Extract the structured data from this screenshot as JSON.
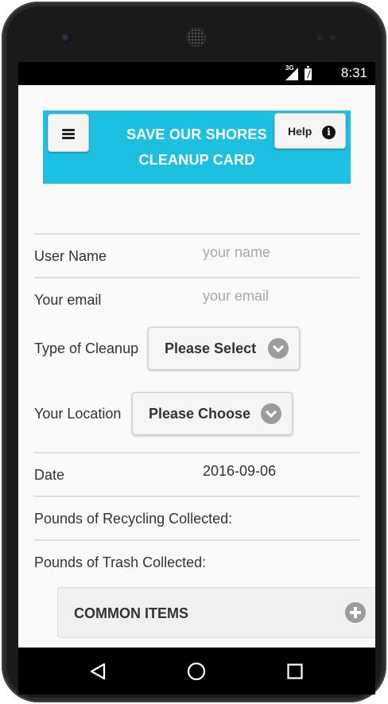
{
  "status_bar": {
    "network": "3G",
    "time": "8:31"
  },
  "header": {
    "title_line1": "SAVE OUR SHORES",
    "title_line2": "CLEANUP CARD",
    "help_label": "Help",
    "background_color": "#1ec0e2"
  },
  "form": {
    "user_name": {
      "label": "User Name",
      "placeholder": "your name"
    },
    "email": {
      "label": "Your email",
      "placeholder": "your email"
    },
    "cleanup_type": {
      "label": "Type of Cleanup",
      "selected": "Please Select"
    },
    "location": {
      "label": "Your Location",
      "selected": "Please Choose"
    },
    "date": {
      "label": "Date",
      "value": "2016-09-06"
    },
    "recycling": {
      "label": "Pounds of Recycling Collected:"
    },
    "trash": {
      "label": "Pounds of Trash Collected:"
    }
  },
  "common_items": {
    "title": "COMMON ITEMS",
    "icon": "plus-circle-icon"
  },
  "navigation": {
    "icons": [
      "back-icon",
      "home-icon",
      "recent-apps-icon"
    ]
  }
}
